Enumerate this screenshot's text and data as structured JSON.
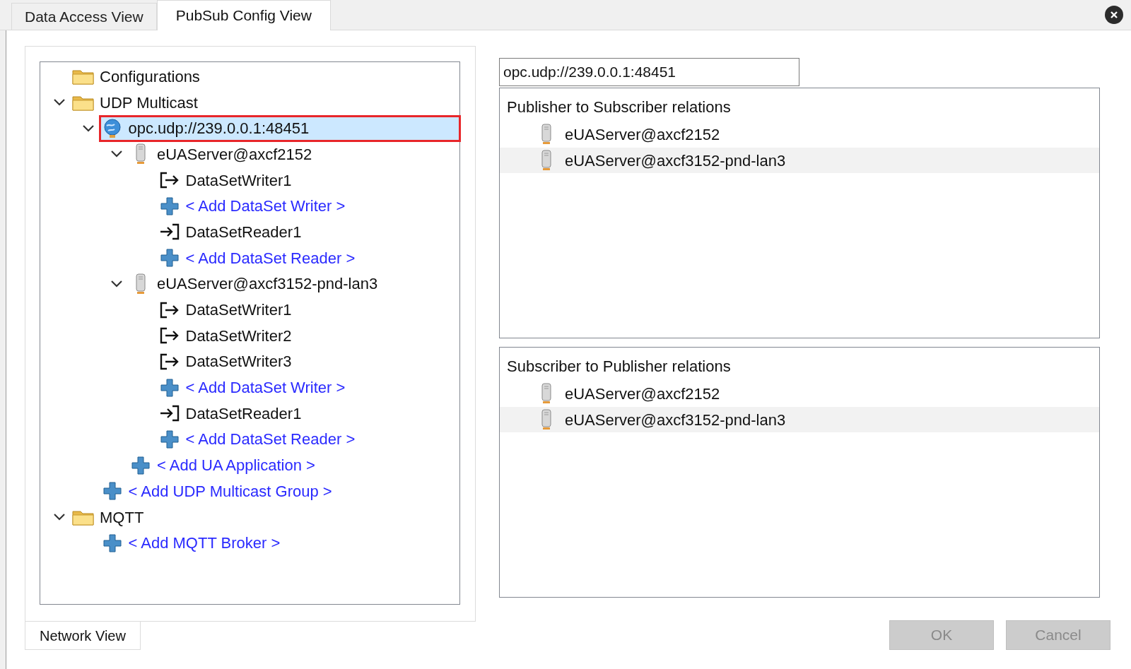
{
  "tabs": [
    {
      "label": "Data Access View",
      "selected": false
    },
    {
      "label": "PubSub Config View",
      "selected": true
    }
  ],
  "tree": [
    {
      "kind": "folder",
      "label": "Configurations",
      "selected": false
    },
    {
      "kind": "folder",
      "label": "UDP Multicast",
      "expanded": true,
      "selected": false,
      "children": [
        {
          "kind": "group",
          "label": "opc.udp://239.0.0.1:48451",
          "expanded": true,
          "selected": true,
          "children": [
            {
              "kind": "server",
              "label": "eUAServer@axcf2152",
              "expanded": true,
              "selected": false,
              "children": [
                {
                  "kind": "writer",
                  "label": "DataSetWriter1",
                  "selected": false
                },
                {
                  "kind": "add",
                  "label": "< Add DataSet Writer >",
                  "selected": false
                },
                {
                  "kind": "reader",
                  "label": "DataSetReader1",
                  "selected": false
                },
                {
                  "kind": "add",
                  "label": "< Add DataSet Reader >",
                  "selected": false
                }
              ]
            },
            {
              "kind": "server",
              "label": "eUAServer@axcf3152-pnd-lan3",
              "expanded": true,
              "selected": false,
              "children": [
                {
                  "kind": "writer",
                  "label": "DataSetWriter1",
                  "selected": false
                },
                {
                  "kind": "writer",
                  "label": "DataSetWriter2",
                  "selected": false
                },
                {
                  "kind": "writer",
                  "label": "DataSetWriter3",
                  "selected": false
                },
                {
                  "kind": "add",
                  "label": "< Add DataSet Writer >",
                  "selected": false
                },
                {
                  "kind": "reader",
                  "label": "DataSetReader1",
                  "selected": false
                },
                {
                  "kind": "add",
                  "label": "< Add DataSet Reader >",
                  "selected": false
                }
              ]
            },
            {
              "kind": "add",
              "label": "< Add UA Application >",
              "selected": false
            }
          ]
        },
        {
          "kind": "add",
          "label": "< Add UDP Multicast Group >",
          "selected": false
        }
      ]
    },
    {
      "kind": "folder",
      "label": "MQTT",
      "expanded": true,
      "selected": false,
      "children": [
        {
          "kind": "add",
          "label": "< Add MQTT Broker >",
          "selected": false
        }
      ]
    }
  ],
  "bottom_tabs": [
    {
      "label": "Network View",
      "selected": true
    }
  ],
  "address_field": {
    "value": "opc.udp://239.0.0.1:48451"
  },
  "relation_panels": [
    {
      "title": "Publisher to Subscriber relations",
      "rows": [
        {
          "label": "eUAServer@axcf2152",
          "selected": false
        },
        {
          "label": "eUAServer@axcf3152-pnd-lan3",
          "selected": true
        }
      ]
    },
    {
      "title": "Subscriber to Publisher relations",
      "rows": [
        {
          "label": "eUAServer@axcf2152",
          "selected": false
        },
        {
          "label": "eUAServer@axcf3152-pnd-lan3",
          "selected": true
        }
      ]
    }
  ],
  "buttons": [
    {
      "label": "OK",
      "disabled": true
    },
    {
      "label": "Cancel",
      "disabled": true
    }
  ]
}
